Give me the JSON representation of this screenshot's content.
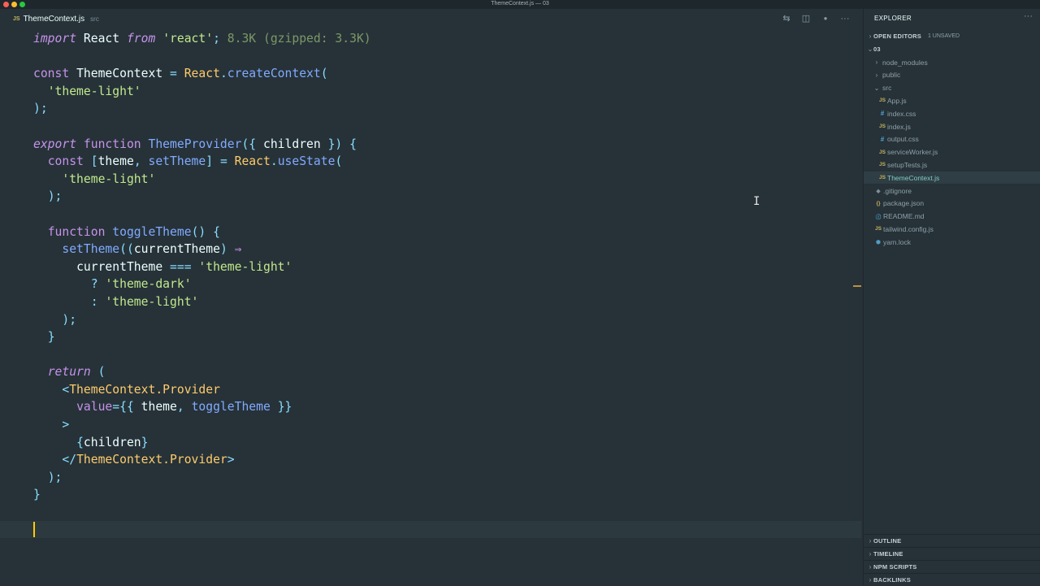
{
  "window": {
    "title": "ThemeContext.js — 03"
  },
  "tab": {
    "icon": "JS",
    "name": "ThemeContext.js",
    "path": "src"
  },
  "tab_actions": [
    {
      "icon": "compare-changes-icon",
      "glyph": "⇆"
    },
    {
      "icon": "split-editor-icon",
      "glyph": "◫"
    },
    {
      "icon": "unsaved-dot-icon",
      "glyph": "●"
    },
    {
      "icon": "more-actions-icon",
      "glyph": "···"
    }
  ],
  "code": {
    "import_kw": "import",
    "react": "React",
    "from_kw": "from",
    "react_str": "'react'",
    "semi": ";",
    "import_cost": "8.3K (gzipped: 3.3K)",
    "const_kw": "const",
    "theme_context": "ThemeContext",
    "eq": "=",
    "create_context": "createContext",
    "theme_light": "'theme-light'",
    "theme_dark": "'theme-dark'",
    "export_kw": "export",
    "function_kw": "function",
    "theme_provider": "ThemeProvider",
    "children": "children",
    "theme": "theme",
    "set_theme": "setTheme",
    "use_state": "useState",
    "toggle_theme": "toggleTheme",
    "current_theme": "currentTheme",
    "arrow": "⇒",
    "strict_eq": "===",
    "return_kw": "return",
    "provider": "ThemeContext.Provider",
    "value_attr": "value"
  },
  "sidebar": {
    "header": "EXPLORER",
    "open_editors": {
      "label": "OPEN EDITORS",
      "badge": "1 UNSAVED"
    },
    "root": "03",
    "tree": [
      {
        "name": "node_modules",
        "type": "folder",
        "depth": 1
      },
      {
        "name": "public",
        "type": "folder",
        "depth": 1
      },
      {
        "name": "src",
        "type": "folder-open",
        "depth": 1
      },
      {
        "name": "App.js",
        "type": "js",
        "depth": 2
      },
      {
        "name": "index.css",
        "type": "css",
        "depth": 2
      },
      {
        "name": "index.js",
        "type": "js",
        "depth": 2
      },
      {
        "name": "output.css",
        "type": "css",
        "depth": 2
      },
      {
        "name": "serviceWorker.js",
        "type": "js",
        "depth": 2
      },
      {
        "name": "setupTests.js",
        "type": "js",
        "depth": 2
      },
      {
        "name": "ThemeContext.js",
        "type": "js",
        "depth": 2,
        "active": true
      },
      {
        "name": ".gitignore",
        "type": "git",
        "depth": 1
      },
      {
        "name": "package.json",
        "type": "json",
        "depth": 1
      },
      {
        "name": "README.md",
        "type": "md",
        "depth": 1
      },
      {
        "name": "tailwind.config.js",
        "type": "js",
        "depth": 1
      },
      {
        "name": "yarn.lock",
        "type": "yarn",
        "depth": 1
      }
    ],
    "bottom_sections": [
      "OUTLINE",
      "TIMELINE",
      "NPM SCRIPTS",
      "BACKLINKS"
    ]
  },
  "colors": {
    "background": "#263238",
    "keyword": "#c792ea",
    "string": "#c3e88d",
    "function": "#82aaff",
    "class": "#ffcb6b",
    "punctuation": "#89ddff",
    "caret": "#ffcc00"
  }
}
